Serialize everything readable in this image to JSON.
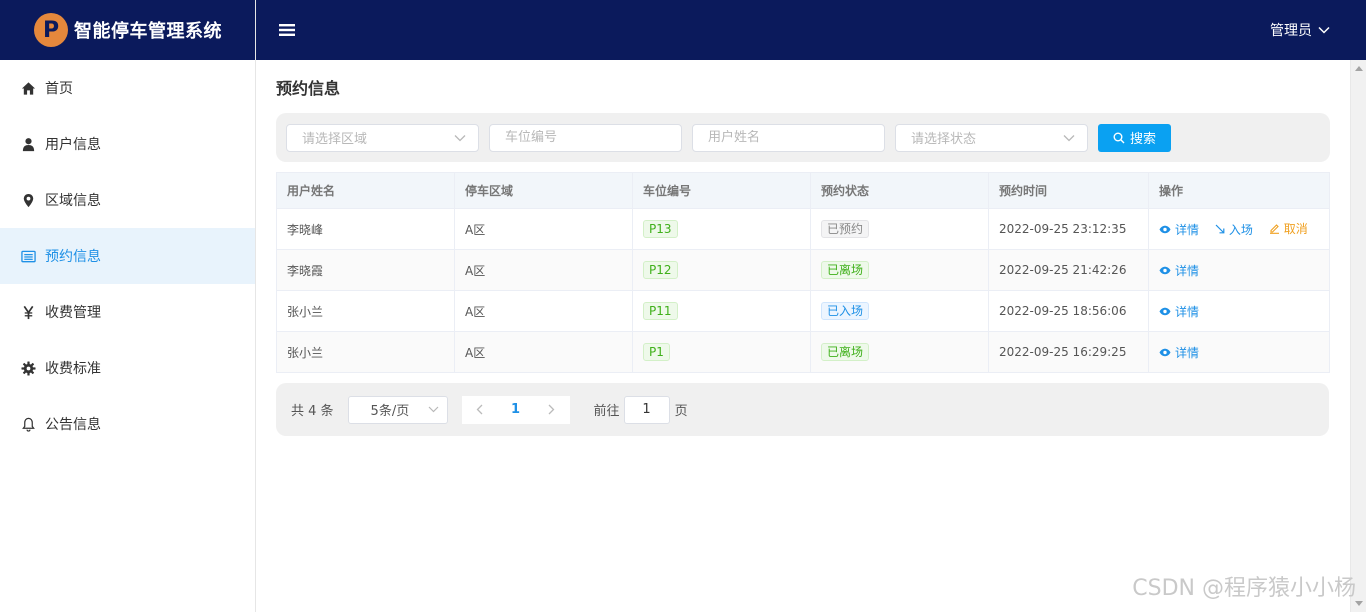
{
  "app": {
    "logo_letter": "P",
    "title": "智能停车管理系统"
  },
  "header": {
    "user": "管理员"
  },
  "sidebar": {
    "items": [
      {
        "label": "首页",
        "icon": "home-icon"
      },
      {
        "label": "用户信息",
        "icon": "user-icon"
      },
      {
        "label": "区域信息",
        "icon": "map-pin-icon"
      },
      {
        "label": "预约信息",
        "icon": "list-icon",
        "active": true
      },
      {
        "label": "收费管理",
        "icon": "yen-icon"
      },
      {
        "label": "收费标准",
        "icon": "gear-icon"
      },
      {
        "label": "公告信息",
        "icon": "bell-icon"
      }
    ]
  },
  "page": {
    "title": "预约信息"
  },
  "filters": {
    "area_placeholder": "请选择区域",
    "spot_placeholder": "车位编号",
    "name_placeholder": "用户姓名",
    "status_placeholder": "请选择状态",
    "search_label": "搜索"
  },
  "table": {
    "headers": [
      "用户姓名",
      "停车区域",
      "车位编号",
      "预约状态",
      "预约时间",
      "操作"
    ],
    "rows": [
      {
        "name": "李晓峰",
        "area": "A区",
        "spot": "P13",
        "status": "已预约",
        "time": "2022-09-25 23:12:35"
      },
      {
        "name": "李晓霞",
        "area": "A区",
        "spot": "P12",
        "status": "已离场",
        "time": "2022-09-25 21:42:26"
      },
      {
        "name": "张小兰",
        "area": "A区",
        "spot": "P11",
        "status": "已入场",
        "time": "2022-09-25 18:56:06"
      },
      {
        "name": "张小兰",
        "area": "A区",
        "spot": "P1",
        "status": "已离场",
        "time": "2022-09-25 16:29:25"
      }
    ],
    "actions": {
      "detail": "详情",
      "enter": "入场",
      "cancel": "取消"
    }
  },
  "pagination": {
    "total": "共 4 条",
    "page_size": "5条/页",
    "current_page": "1",
    "goto_label": "前往",
    "goto_value": "1",
    "goto_unit": "页"
  },
  "watermark": "CSDN @程序猿小小杨",
  "colors": {
    "header_bg": "#0b1a5c",
    "accent": "#1e90e6",
    "search_button": "#0aa1f2",
    "logo_circle": "#e5883c",
    "cancel_action": "#f0a020"
  }
}
